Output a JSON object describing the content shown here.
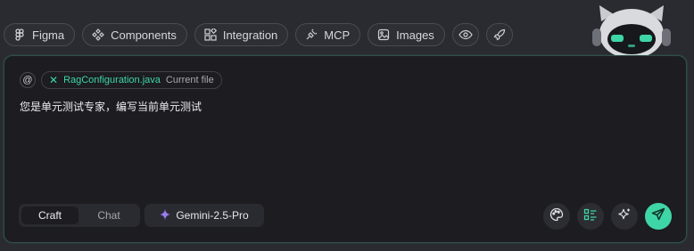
{
  "toolbar": {
    "chips": [
      {
        "label": "Figma",
        "icon": "figma-icon"
      },
      {
        "label": "Components",
        "icon": "components-icon"
      },
      {
        "label": "Integration",
        "icon": "integration-icon"
      },
      {
        "label": "MCP",
        "icon": "plug-icon"
      },
      {
        "label": "Images",
        "icon": "image-icon"
      }
    ],
    "icon_chips": [
      "eye-icon",
      "rocket-icon"
    ]
  },
  "context": {
    "at_symbol": "@",
    "file_name": "RagConfiguration.java",
    "file_tag": "Current file"
  },
  "prompt": {
    "text": "您是单元测试专家，编写当前单元测试"
  },
  "footer": {
    "modes": [
      {
        "label": "Craft",
        "active": true
      },
      {
        "label": "Chat",
        "active": false
      }
    ],
    "model": "Gemini-2.5-Pro",
    "tools": [
      "palette-icon",
      "checklist-icon",
      "sparkle-icon"
    ],
    "send_icon": "send-icon"
  },
  "colors": {
    "accent": "#3fd6a5",
    "background": "#2a2b30",
    "panel": "#1c1c21",
    "gemini": "#9b7bf0"
  }
}
